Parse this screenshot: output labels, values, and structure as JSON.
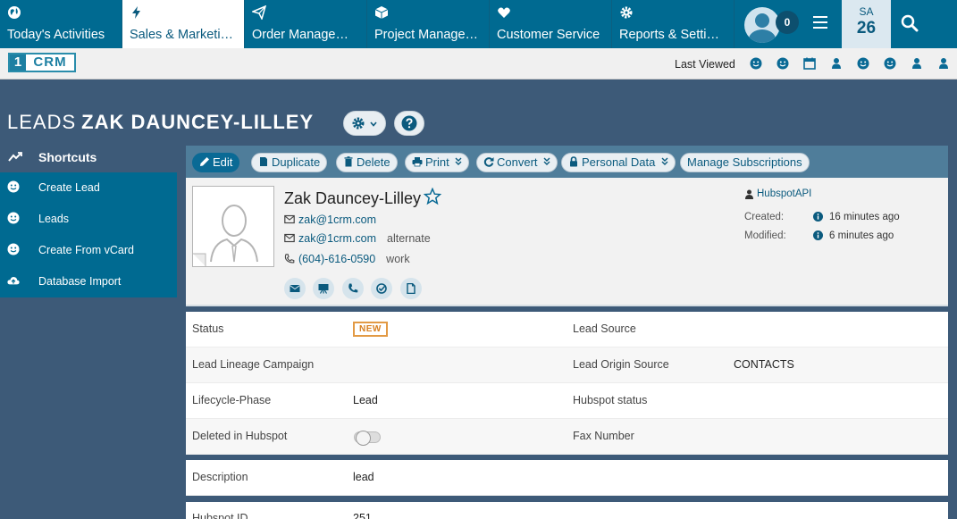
{
  "nav": {
    "tabs": [
      {
        "label": "Today's Activities",
        "icon": "globe-icon"
      },
      {
        "label": "Sales & Marketi…",
        "icon": "bolt-icon"
      },
      {
        "label": "Order Manage…",
        "icon": "paper-plane-icon"
      },
      {
        "label": "Project Manage…",
        "icon": "cube-icon"
      },
      {
        "label": "Customer Service",
        "icon": "heart-icon"
      },
      {
        "label": "Reports & Setti…",
        "icon": "gear-icon"
      }
    ],
    "notification_count": "0",
    "date_dow": "SA",
    "date_day": "26"
  },
  "subbar": {
    "logo_one": "1",
    "logo_crm": "CRM",
    "last_viewed_label": "Last Viewed"
  },
  "title": {
    "module": "LEADS",
    "name": "ZAK DAUNCEY-LILLEY"
  },
  "sidebar": {
    "heading": "Shortcuts",
    "items": [
      {
        "label": "Create Lead"
      },
      {
        "label": "Leads"
      },
      {
        "label": "Create From vCard"
      },
      {
        "label": "Database Import"
      }
    ]
  },
  "actions": {
    "edit": "Edit",
    "duplicate": "Duplicate",
    "delete": "Delete",
    "print": "Print",
    "convert": "Convert",
    "personal_data": "Personal Data",
    "manage_subscriptions": "Manage Subscriptions"
  },
  "lead": {
    "full_name": "Zak Dauncey-Lilley",
    "email_primary": "zak@1crm.com",
    "email_alt": "zak@1crm.com",
    "email_alt_tag": "alternate",
    "phone": "(604)-616-0590",
    "phone_tag": "work",
    "assigned_user": "HubspotAPI",
    "created_label": "Created:",
    "created_value": "16 minutes ago",
    "modified_label": "Modified:",
    "modified_value": "6 minutes ago"
  },
  "details": {
    "status_label": "Status",
    "status_value": "NEW",
    "lead_source_label": "Lead Source",
    "lead_source_value": "",
    "lineage_label": "Lead Lineage Campaign",
    "lineage_value": "",
    "origin_label": "Lead Origin Source",
    "origin_value": "CONTACTS",
    "lifecycle_label": "Lifecycle-Phase",
    "lifecycle_value": "Lead",
    "hubspot_status_label": "Hubspot status",
    "hubspot_status_value": "",
    "deleted_label": "Deleted in Hubspot",
    "deleted_value": false,
    "fax_label": "Fax Number",
    "fax_value": "",
    "description_label": "Description",
    "description_value": "lead",
    "hubspot_id_label": "Hubspot ID",
    "hubspot_id_value": "251"
  },
  "colors": {
    "nav_bg": "#006a91",
    "page_bg": "#3d5a78",
    "accent": "#0a5a7e",
    "new_badge": "#e29a45"
  }
}
